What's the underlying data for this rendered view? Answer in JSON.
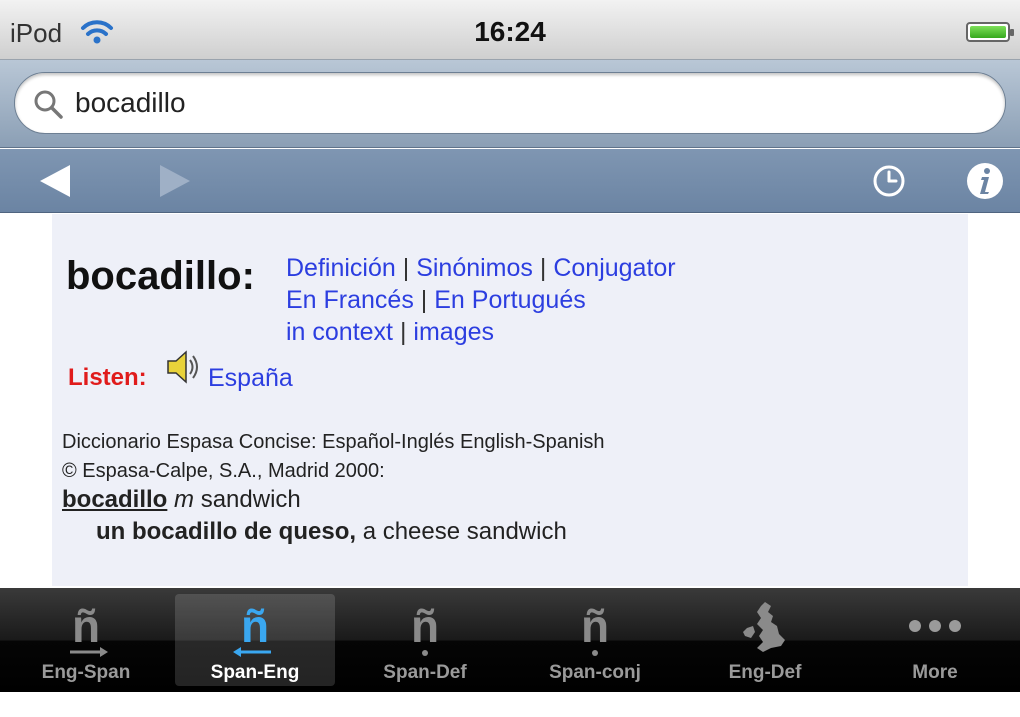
{
  "status_bar": {
    "carrier": "iPod",
    "time": "16:24"
  },
  "search": {
    "value": "bocadillo"
  },
  "entry": {
    "headword": "bocadillo:",
    "links": {
      "definicion": "Definición",
      "sinonimos": "Sinónimos",
      "conjugator": "Conjugator",
      "en_frances": "En Francés",
      "en_portugues": "En Portugués",
      "in_context": "in context",
      "images": "images",
      "separator": "|"
    },
    "listen_label": "Listen:",
    "listen_link": "España",
    "source_line1": "Diccionario Espasa Concise: Español-Inglés English-Spanish",
    "source_line2": "© Espasa-Calpe, S.A., Madrid 2000:",
    "entry_word": "bocadillo",
    "entry_gender": "m",
    "entry_translation": "sandwich",
    "example_phrase": "un bocadillo de queso,",
    "example_translation": "a cheese sandwich"
  },
  "tabs": [
    {
      "label": "Eng-Span",
      "icon": "n-tilde-arrow-right-icon",
      "active": false
    },
    {
      "label": "Span-Eng",
      "icon": "n-tilde-arrow-left-icon",
      "active": true
    },
    {
      "label": "Span-Def",
      "icon": "n-tilde-dot-icon",
      "active": false
    },
    {
      "label": "Span-conj",
      "icon": "n-tilde-dot-icon",
      "active": false
    },
    {
      "label": "Eng-Def",
      "icon": "uk-map-icon",
      "active": false
    },
    {
      "label": "More",
      "icon": "more-dots-icon",
      "active": false
    }
  ],
  "colors": {
    "link": "#2c3ee0",
    "listen": "#e01b1b",
    "active_tab_icon": "#3aa7f0"
  }
}
